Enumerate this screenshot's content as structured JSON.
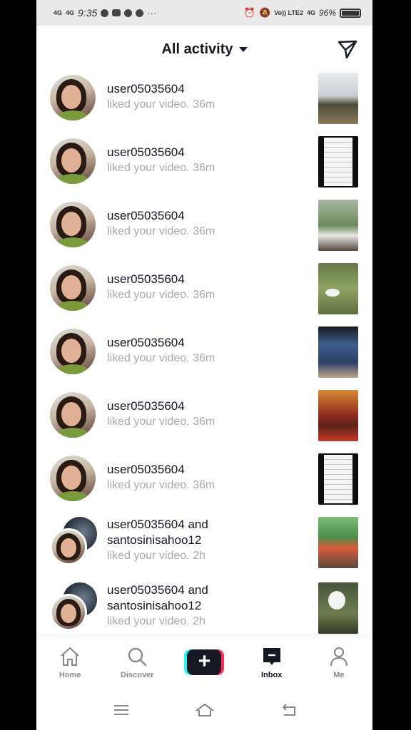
{
  "status_bar": {
    "signal_1": "4G",
    "signal_2": "4G",
    "time": "9:35",
    "carrier": "Vo)) LTE2",
    "network": "4G",
    "battery": "96%"
  },
  "header": {
    "title": "All activity"
  },
  "notifications": [
    {
      "user": "user05035604",
      "action": "liked your video. 36m"
    },
    {
      "user": "user05035604",
      "action": "liked your video. 36m"
    },
    {
      "user": "user05035604",
      "action": "liked your video. 36m"
    },
    {
      "user": "user05035604",
      "action": "liked your video. 36m"
    },
    {
      "user": "user05035604",
      "action": "liked your video. 36m"
    },
    {
      "user": "user05035604",
      "action": "liked your video. 36m"
    },
    {
      "user": "user05035604",
      "action": "liked your video. 36m"
    },
    {
      "user": "user05035604",
      "and": "and",
      "user2": "santosinisahoo12",
      "action": "liked your video. 2h"
    },
    {
      "user": "user05035604",
      "and": "and",
      "user2": "santosinisahoo12",
      "action": "liked your video. 2h"
    }
  ],
  "bottom_nav": {
    "home": "Home",
    "discover": "Discover",
    "create": "+",
    "inbox": "Inbox",
    "me": "Me"
  }
}
